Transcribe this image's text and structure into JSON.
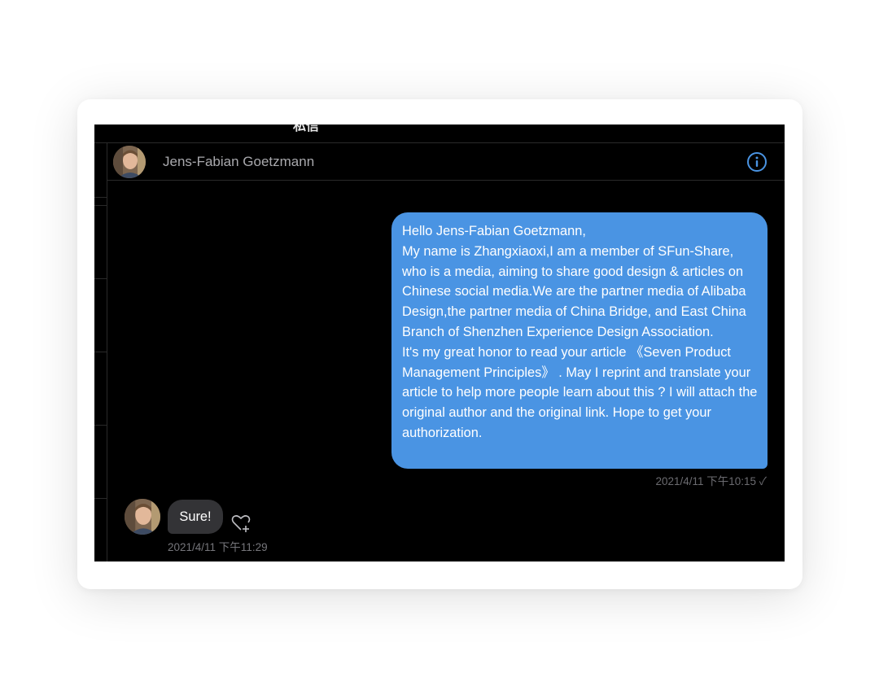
{
  "topbar": {
    "title": "私信",
    "settings_icon": "gear-icon"
  },
  "conversation": {
    "contact_name": "Jens-Fabian Goetzmann",
    "info_icon": "info-icon",
    "avatar_icon": "avatar-photo"
  },
  "messages": {
    "outgoing": {
      "text": "Hello Jens-Fabian Goetzmann,\nMy name is Zhangxiaoxi,I am a member of SFun-Share, who is a media, aiming to share good design & articles on Chinese social media.We are the partner media of Alibaba Design,the partner media of China Bridge,   and East China Branch of Shenzhen Experience Design Association.\nIt's my great honor to read your article 《Seven Product Management Principles》 . May I reprint and translate your article to help more people learn about this ? I will attach the original author and the original link. Hope to get your authorization.",
      "timestamp": "2021/4/11 下午10:15 ✓",
      "color": "#4a94e3"
    },
    "incoming": {
      "text": "Sure!",
      "timestamp": "2021/4/11 下午11:29",
      "reaction_icon": "heart-plus-icon",
      "color": "#333336"
    }
  },
  "colors": {
    "background": "#000000",
    "accent": "#4a94e3",
    "name_text": "#a9a9ad",
    "timestamp_text": "#6b6b70"
  }
}
